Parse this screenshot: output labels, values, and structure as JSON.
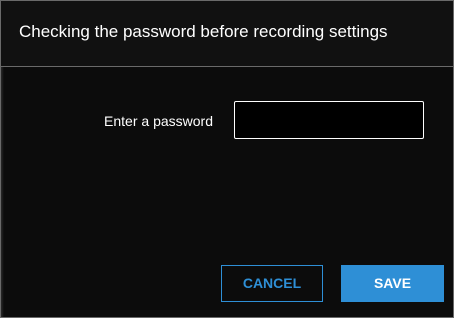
{
  "dialog": {
    "title": "Checking the password before recording settings",
    "password_field": {
      "label": "Enter a password",
      "value": "",
      "placeholder": ""
    },
    "buttons": {
      "cancel_label": "CANCEL",
      "save_label": "SAVE"
    }
  },
  "colors": {
    "background": "#0c0c0c",
    "accent": "#2e8fd6",
    "text": "#ffffff",
    "border": "#6a6a6a"
  }
}
